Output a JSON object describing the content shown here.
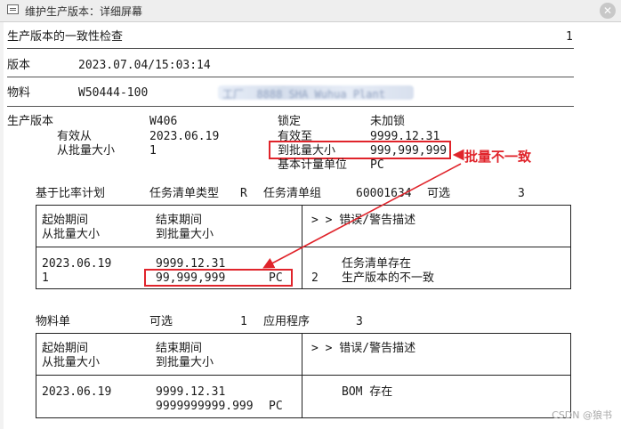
{
  "window": {
    "title": "维护生产版本：详细屏幕",
    "close_symbol": "✕"
  },
  "header": {
    "title": "生产版本的一致性检查",
    "page_number": "1"
  },
  "version": {
    "label": "版本",
    "value": "2023.07.04/15:03:14"
  },
  "material": {
    "label": "物料",
    "value": "W50444-100",
    "plant_blurred": "工厂  8888 SHA Wuhua Plant"
  },
  "prod_version": {
    "label": "生产版本",
    "value": "W406",
    "lock_label": "锁定",
    "lock_value": "未加锁",
    "valid_from_label": "有效从",
    "valid_from": "2023.06.19",
    "valid_to_label": "有效至",
    "valid_to": "9999.12.31",
    "lot_from_label": "从批量大小",
    "lot_from": "1",
    "lot_to_label": "到批量大小",
    "lot_to": "999,999,999",
    "base_unit_label": "基本计量单位",
    "base_unit": "PC"
  },
  "annotation": {
    "text": "批量不一致"
  },
  "routing": {
    "label": "基于比率计划",
    "type_label": "任务清单类型",
    "type_value": "R",
    "group_label": "任务清单组",
    "group_value": "60001634",
    "optional_label": "可选",
    "optional_value": "3",
    "col_start_period": "起始期间",
    "col_from_lot": "从批量大小",
    "col_end_period": "结束期间",
    "col_to_lot": "到批量大小",
    "col_msg": "> > 错误/警告描述",
    "row": {
      "start": "2023.06.19",
      "from_lot": "1",
      "end": "9999.12.31",
      "to_lot": "99,999,999",
      "unit": "PC",
      "msg_line1": "任务清单存在",
      "msg_num": "2",
      "msg_line2": "生产版本的不一致"
    }
  },
  "bom": {
    "label": "物料单",
    "optional_label": "可选",
    "optional_value": "1",
    "app_label": "应用程序",
    "app_value": "3",
    "col_start_period": "起始期间",
    "col_from_lot": "从批量大小",
    "col_end_period": "结束期间",
    "col_to_lot": "到批量大小",
    "col_msg": "> > 错误/警告描述",
    "row": {
      "start": "2023.06.19",
      "end": "9999.12.31",
      "to_lot": "9999999999.999",
      "unit": "PC",
      "msg": "BOM 存在"
    }
  },
  "watermark": "CSDN @狼书",
  "colors": {
    "highlight": "#e0242b",
    "titlebar": "#eeeeee"
  }
}
